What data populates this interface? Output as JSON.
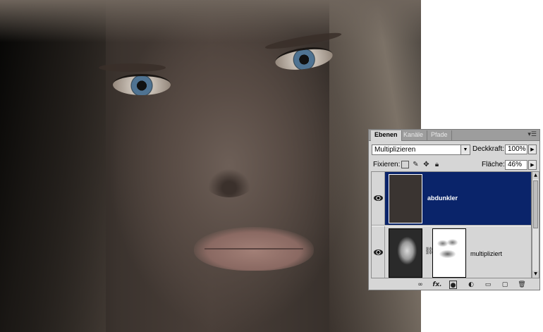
{
  "panel": {
    "tabs": [
      {
        "label": "Ebenen",
        "active": true
      },
      {
        "label": "Kanäle",
        "active": false
      },
      {
        "label": "Pfade",
        "active": false
      }
    ],
    "menu_icon": "panel-menu-icon",
    "blend_mode": "Multiplizieren",
    "opacity_label": "Deckkraft:",
    "opacity_value": "100%",
    "lock_label": "Fixieren:",
    "fill_label": "Fläche:",
    "fill_value": "46%",
    "lock_icons": [
      "lock-transparent-icon",
      "lock-brush-icon",
      "lock-move-icon",
      "lock-all-icon"
    ],
    "layers": [
      {
        "name": "abdunkler",
        "selected": true,
        "thumb_color": "#3a3431"
      },
      {
        "name": "multipliziert",
        "selected": false,
        "has_mask": true
      }
    ],
    "footer_icons": [
      "link-icon",
      "fx-icon",
      "mask-icon",
      "adjustment-icon",
      "folder-icon",
      "new-layer-icon",
      "trash-icon"
    ],
    "footer_glyphs": {
      "fx": "fx."
    },
    "colors": {
      "selection": "#0a246a",
      "panel_bg": "#d6d6d6"
    }
  }
}
